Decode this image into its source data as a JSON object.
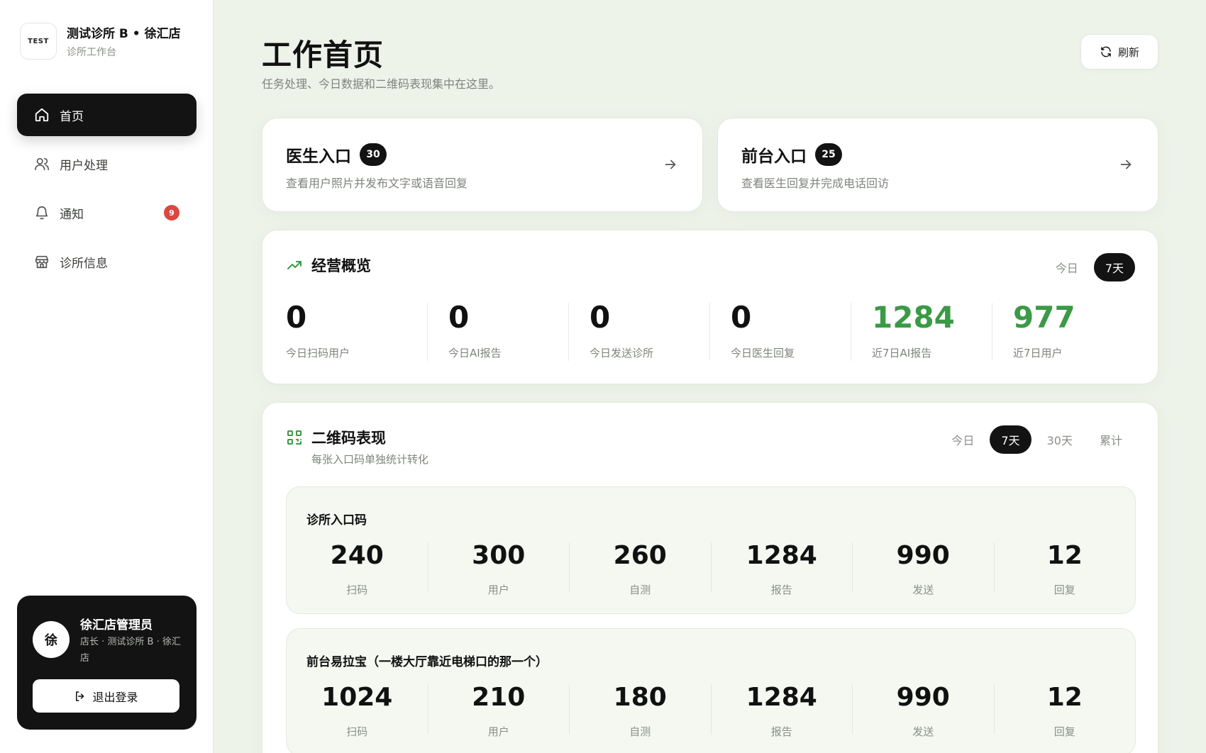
{
  "brand": {
    "logo_text": "TEST",
    "title": "测试诊所 B • 徐汇店",
    "subtitle": "诊所工作台"
  },
  "nav": [
    {
      "label": "首页",
      "icon": "home-icon",
      "active": true
    },
    {
      "label": "用户处理",
      "icon": "users-icon"
    },
    {
      "label": "通知",
      "icon": "bell-icon",
      "badge": "9"
    },
    {
      "label": "诊所信息",
      "icon": "store-icon"
    }
  ],
  "user": {
    "avatar": "徐",
    "name": "徐汇店管理员",
    "role": "店长 · 测试诊所 B · 徐汇店",
    "logout_label": "退出登录"
  },
  "header": {
    "title": "工作首页",
    "subtitle": "任务处理、今日数据和二维码表现集中在这里。",
    "refresh_label": "刷新"
  },
  "entries": [
    {
      "title": "医生入口",
      "count": "30",
      "desc": "查看用户照片并发布文字或语音回复"
    },
    {
      "title": "前台入口",
      "count": "25",
      "desc": "查看医生回复并完成电话回访"
    }
  ],
  "overview": {
    "title": "经营概览",
    "tabs": [
      "今日",
      "7天"
    ],
    "active_tab": "7天",
    "stats": [
      {
        "value": "0",
        "label": "今日扫码用户"
      },
      {
        "value": "0",
        "label": "今日AI报告"
      },
      {
        "value": "0",
        "label": "今日发送诊所"
      },
      {
        "value": "0",
        "label": "今日医生回复"
      },
      {
        "value": "1284",
        "label": "近7日AI报告",
        "accent": true
      },
      {
        "value": "977",
        "label": "近7日用户",
        "accent": true
      }
    ]
  },
  "qr": {
    "title": "二维码表现",
    "subtitle": "每张入口码单独统计转化",
    "tabs": [
      "今日",
      "7天",
      "30天",
      "累计"
    ],
    "active_tab": "7天",
    "codes": [
      {
        "name": "诊所入口码",
        "stats": [
          {
            "value": "240",
            "label": "扫码"
          },
          {
            "value": "300",
            "label": "用户"
          },
          {
            "value": "260",
            "label": "自测"
          },
          {
            "value": "1284",
            "label": "报告"
          },
          {
            "value": "990",
            "label": "发送"
          },
          {
            "value": "12",
            "label": "回复"
          }
        ]
      },
      {
        "name": "前台易拉宝（一楼大厅靠近电梯口的那一个）",
        "stats": [
          {
            "value": "1024",
            "label": "扫码"
          },
          {
            "value": "210",
            "label": "用户"
          },
          {
            "value": "180",
            "label": "自测"
          },
          {
            "value": "1284",
            "label": "报告"
          },
          {
            "value": "990",
            "label": "发送"
          },
          {
            "value": "12",
            "label": "回复"
          }
        ]
      }
    ]
  },
  "colors": {
    "accent": "#3b9a46",
    "dark": "#121312",
    "badge": "#d9473f",
    "background": "#eef3ea"
  }
}
